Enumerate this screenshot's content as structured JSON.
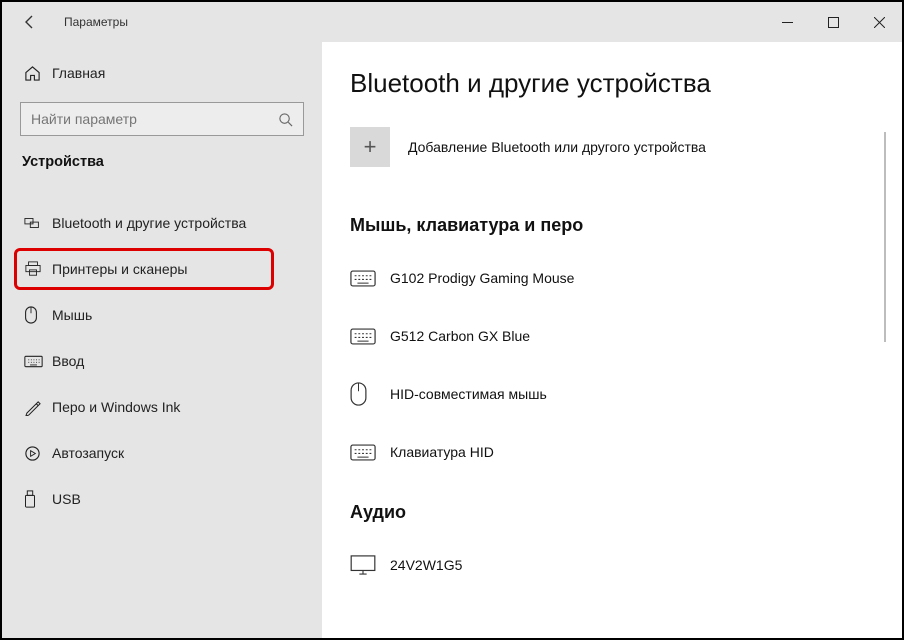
{
  "titlebar": {
    "title": "Параметры"
  },
  "sidebar": {
    "home": "Главная",
    "search_placeholder": "Найти параметр",
    "category": "Устройства",
    "items": [
      {
        "label": "Bluetooth и другие устройства"
      },
      {
        "label": "Принтеры и сканеры"
      },
      {
        "label": "Мышь"
      },
      {
        "label": "Ввод"
      },
      {
        "label": "Перо и Windows Ink"
      },
      {
        "label": "Автозапуск"
      },
      {
        "label": "USB"
      }
    ]
  },
  "main": {
    "heading": "Bluetooth и другие устройства",
    "add_label": "Добавление Bluetooth или другого устройства",
    "sections": {
      "mkp": {
        "title": "Мышь, клавиатура и перо",
        "devices": [
          {
            "name": "G102 Prodigy Gaming Mouse"
          },
          {
            "name": "G512 Carbon GX Blue"
          },
          {
            "name": "HID-совместимая мышь"
          },
          {
            "name": "Клавиатура HID"
          }
        ]
      },
      "audio": {
        "title": "Аудио",
        "devices": [
          {
            "name": "24V2W1G5"
          }
        ]
      }
    }
  }
}
